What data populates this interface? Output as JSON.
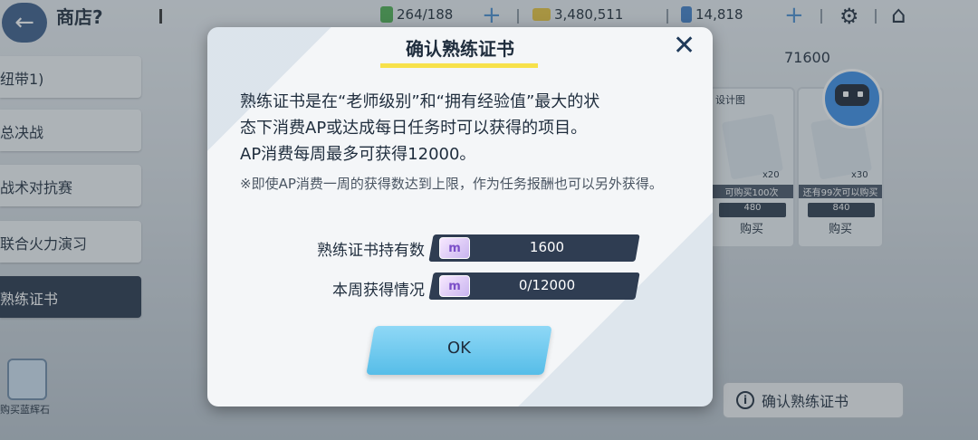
{
  "header": {
    "back_icon": "back-arrow-icon",
    "title": "商店?",
    "ap": "264/188",
    "credits": "3,480,511",
    "gems": "14,818",
    "colors": {
      "ap": "#4caf50",
      "credits": "#e8c43a",
      "gems": "#3f7ec9"
    }
  },
  "sidebar": {
    "items": [
      {
        "label": "纽带1)"
      },
      {
        "label": "总决战"
      },
      {
        "label": "战术对抗赛"
      },
      {
        "label": "联合火力演习"
      },
      {
        "label": "熟练证书"
      }
    ],
    "gem_shop_label": "购买蓝辉石"
  },
  "shop": {
    "top_price": "71600",
    "cards": [
      {
        "tag": "设计图",
        "qty": "x20",
        "limit": "可购买100次",
        "price": "480",
        "buy": "购买"
      },
      {
        "tag": "",
        "qty": "x30",
        "limit": "还有99次可以购买",
        "price": "840",
        "buy": "购买"
      }
    ],
    "confirm_button": "确认熟练证书"
  },
  "modal": {
    "title": "确认熟练证书",
    "desc_line1": "熟练证书是在“老师级别”和“拥有经验值”最大的状",
    "desc_line2": "态下消费AP或达成每日任务时可以获得的项目。",
    "desc_line3": "AP消费每周最多可获得12000。",
    "note": "※即使AP消费一周的获得数达到上限，作为任务报酬也可以另外获得。",
    "rows": [
      {
        "label": "熟练证书持有数",
        "value": "1600"
      },
      {
        "label": "本周获得情况",
        "value": "0/12000"
      }
    ],
    "ok_label": "OK",
    "accent_color": "#f7e14a"
  }
}
